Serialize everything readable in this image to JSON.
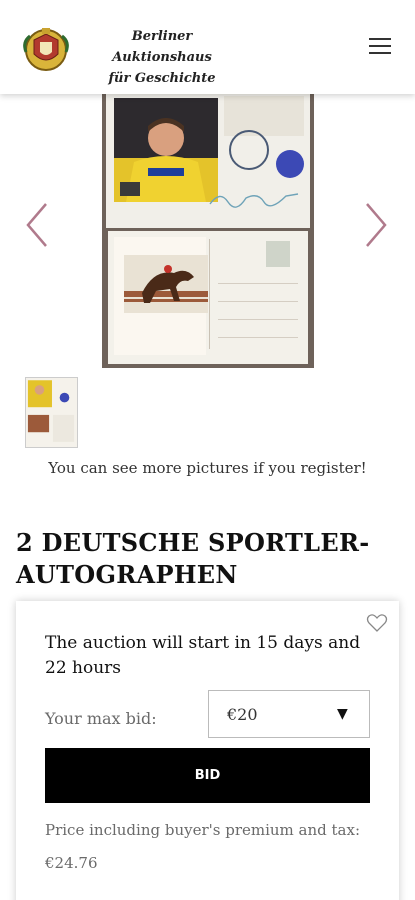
{
  "header": {
    "brand_line1": "Berliner Auktionshaus",
    "brand_line2": "für Geschichte"
  },
  "gallery": {
    "more_pictures_text": "You can see more pictures if you register!"
  },
  "lot": {
    "title_line1": "2 DEUTSCHE SPORTLER-",
    "title_line2": "AUTOGRAPHEN"
  },
  "bid_panel": {
    "start_text": "The auction will start in 15 days and 22 hours",
    "max_bid_label": "Your max bid:",
    "max_bid_value": "€20",
    "bid_button": "BID",
    "price_label": "Price including buyer's premium and tax:",
    "price_value": "€24.76"
  },
  "colors": {
    "accent_arrow": "#b07a8c",
    "button_bg": "#000000"
  },
  "icons": [
    "logo-crest",
    "hamburger-menu-icon",
    "chevron-left-icon",
    "chevron-right-icon",
    "heart-icon",
    "caret-down-icon"
  ]
}
